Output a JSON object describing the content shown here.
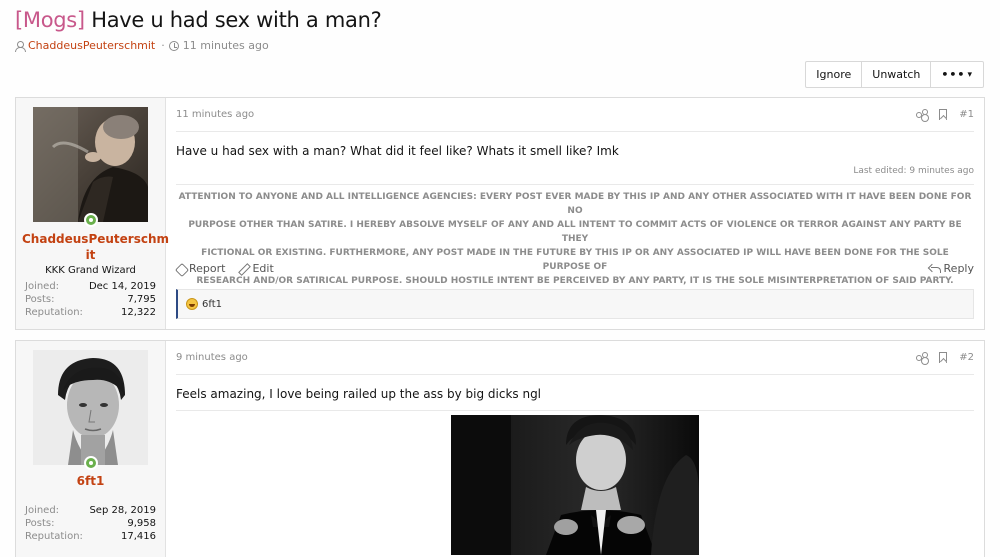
{
  "thread": {
    "prefix": "[Mogs]",
    "title": "Have u had sex with a man?",
    "author": "ChaddeusPeuterschmit",
    "time": "11 minutes ago"
  },
  "actions": {
    "ignore": "Ignore",
    "unwatch": "Unwatch",
    "more": "•••",
    "more_caret": "▾"
  },
  "posts": [
    {
      "username_line1": "ChaddeusPeuterschm",
      "username_line2": "it",
      "user_title": "KKK Grand Wizard",
      "joined_label": "Joined:",
      "joined": "Dec 14, 2019",
      "posts_label": "Posts:",
      "posts": "7,795",
      "rep_label": "Reputation:",
      "reputation": "12,322",
      "time": "11 minutes ago",
      "number": "#1",
      "body": "Have u had sex with a man? What did it feel like? Whats it smell like? Imk",
      "last_edited": "Last edited: 9 minutes ago",
      "signature_1": "ATTENTION TO ANYONE AND ALL INTELLIGENCE AGENCIES: EVERY POST EVER MADE BY THIS IP AND ANY OTHER ASSOCIATED WITH IT HAVE BEEN DONE FOR NO",
      "signature_2": "PURPOSE OTHER THAN SATIRE. I HEREBY ABSOLVE MYSELF OF ANY AND ALL INTENT TO COMMIT ACTS OF VIOLENCE OR TERROR AGAINST ANY PARTY BE THEY",
      "signature_3": "FICTIONAL OR EXISTING. FURTHERMORE, ANY POST MADE IN THE FUTURE BY THIS IP OR ANY ASSOCIATED IP WILL HAVE BEEN DONE FOR THE SOLE PURPOSE OF",
      "signature_4": "RESEARCH AND/OR SATIRICAL PURPOSE. SHOULD HOSTILE INTENT BE PERCEIVED BY ANY PARTY, IT IS THE SOLE MISINTERPRETATION OF SAID PARTY.",
      "report": "Report",
      "edit": "Edit",
      "reply": "Reply",
      "reaction_user": "6ft1"
    },
    {
      "username": "6ft1",
      "joined_label": "Joined:",
      "joined": "Sep 28, 2019",
      "posts_label": "Posts:",
      "posts": "9,958",
      "rep_label": "Reputation:",
      "reputation": "17,416",
      "time": "9 minutes ago",
      "number": "#2",
      "body": "Feels amazing, I love being railed up the ass by big dicks ngl"
    }
  ],
  "icons": [
    "person-icon",
    "clock-icon",
    "share-icon",
    "bookmark-icon",
    "flag-icon",
    "pencil-icon",
    "reply-icon",
    "laugh-emoji-icon",
    "online-status-icon"
  ]
}
